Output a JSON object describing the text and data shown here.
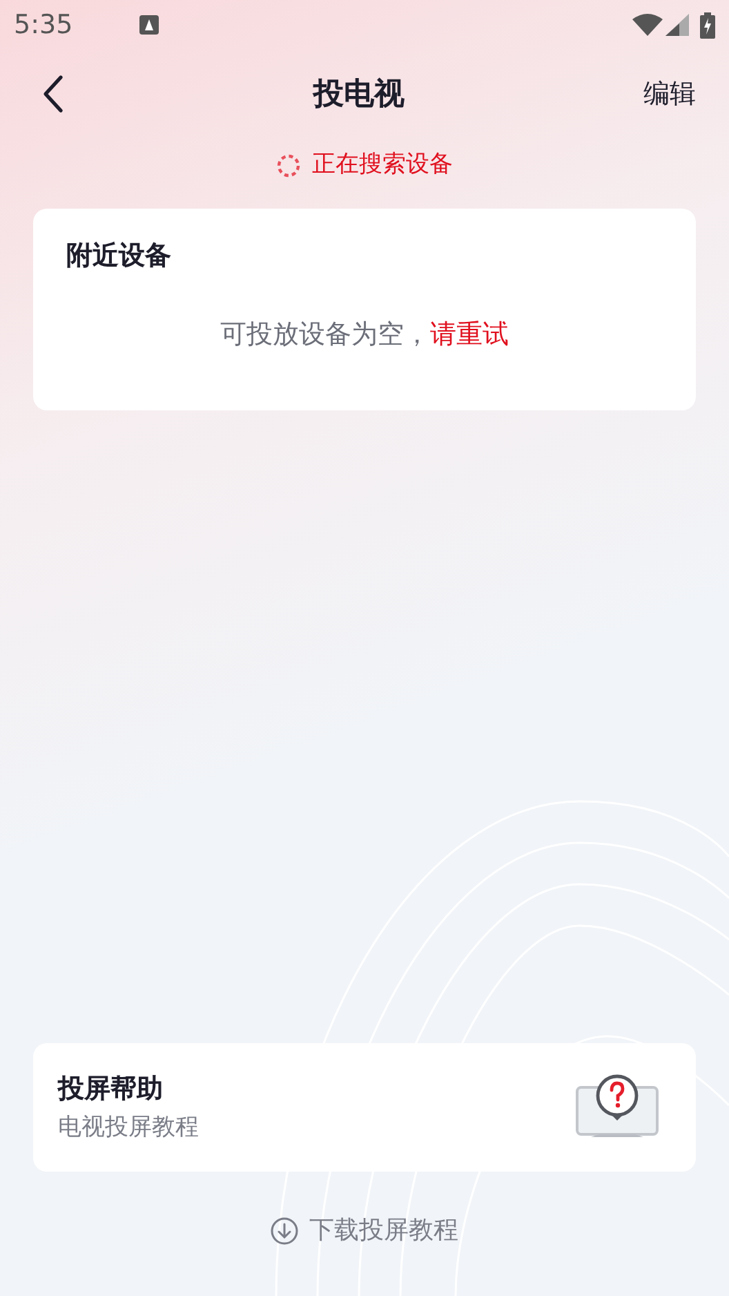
{
  "status_bar": {
    "time": "5:35"
  },
  "header": {
    "title": "投电视",
    "action": "编辑"
  },
  "search_status": {
    "text": "正在搜索设备"
  },
  "nearby_devices": {
    "title": "附近设备",
    "empty_text": "可投放设备为空，",
    "retry_link": "请重试"
  },
  "help_card": {
    "title": "投屏帮助",
    "subtitle": "电视投屏教程"
  },
  "download_link": {
    "label": "下载投屏教程"
  }
}
